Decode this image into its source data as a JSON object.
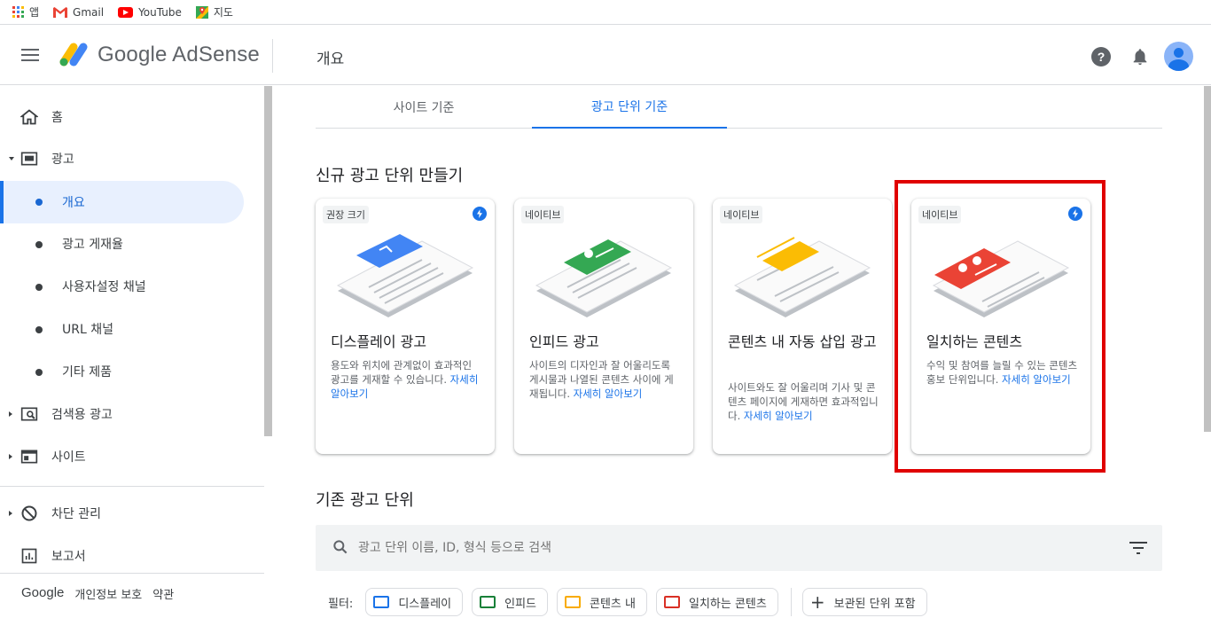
{
  "bookmarks": [
    {
      "label": "앱",
      "icon": "apps-grid-icon"
    },
    {
      "label": "Gmail",
      "icon": "gmail-icon"
    },
    {
      "label": "YouTube",
      "icon": "youtube-icon"
    },
    {
      "label": "지도",
      "icon": "maps-icon"
    }
  ],
  "header": {
    "logo_text": "Google AdSense",
    "page_title": "개요"
  },
  "sidebar": {
    "items": [
      {
        "label": "홈",
        "icon": "home-icon"
      },
      {
        "label": "광고",
        "icon": "ads-icon"
      },
      {
        "label": "개요"
      },
      {
        "label": "광고 게재율"
      },
      {
        "label": "사용자설정 채널"
      },
      {
        "label": "URL 채널"
      },
      {
        "label": "기타 제품"
      },
      {
        "label": "검색용 광고",
        "icon": "search-ads-icon"
      },
      {
        "label": "사이트",
        "icon": "sites-icon"
      },
      {
        "label": "차단 관리",
        "icon": "block-icon"
      },
      {
        "label": "보고서",
        "icon": "reports-icon"
      }
    ],
    "footer": {
      "google": "Google",
      "privacy": "개인정보 보호",
      "terms": "약관"
    }
  },
  "tabs": [
    {
      "label": "사이트 기준"
    },
    {
      "label": "광고 단위 기준"
    }
  ],
  "new_section_title": "신규 광고 단위 만들기",
  "cards": [
    {
      "tag": "권장 크기",
      "title": "디스플레이 광고",
      "desc": "용도와 위치에 관계없이 효과적인 광고를 게재할 수 있습니다.",
      "link": "자세히 알아보기",
      "accent": "#4285f4"
    },
    {
      "tag": "네이티브",
      "title": "인피드 광고",
      "desc": "사이트의 디자인과 잘 어울리도록 게시물과 나열된 콘텐츠 사이에 게재됩니다.",
      "link": "자세히 알아보기",
      "accent": "#34a853"
    },
    {
      "tag": "네이티브",
      "title": "콘텐츠 내 자동 삽입 광고",
      "desc": "사이트와도 잘 어울리며 기사 및 콘텐츠 페이지에 게재하면 효과적입니다.",
      "link": "자세히 알아보기",
      "accent": "#fbbc04"
    },
    {
      "tag": "네이티브",
      "title": "일치하는 콘텐츠",
      "desc": "수익 및 참여를 늘릴 수 있는 콘텐츠 홍보 단위입니다.",
      "link": "자세히 알아보기",
      "accent": "#ea4335"
    }
  ],
  "existing_section_title": "기존 광고 단위",
  "search": {
    "placeholder": "광고 단위 이름, ID, 형식 등으로 검색"
  },
  "filters": {
    "label": "필터:",
    "chips": [
      {
        "label": "디스플레이",
        "color": "#1a73e8"
      },
      {
        "label": "인피드",
        "color": "#188038"
      },
      {
        "label": "콘텐츠 내",
        "color": "#f9ab00"
      },
      {
        "label": "일치하는 콘텐츠",
        "color": "#d93025"
      }
    ],
    "archived": "보관된 단위 포함"
  }
}
